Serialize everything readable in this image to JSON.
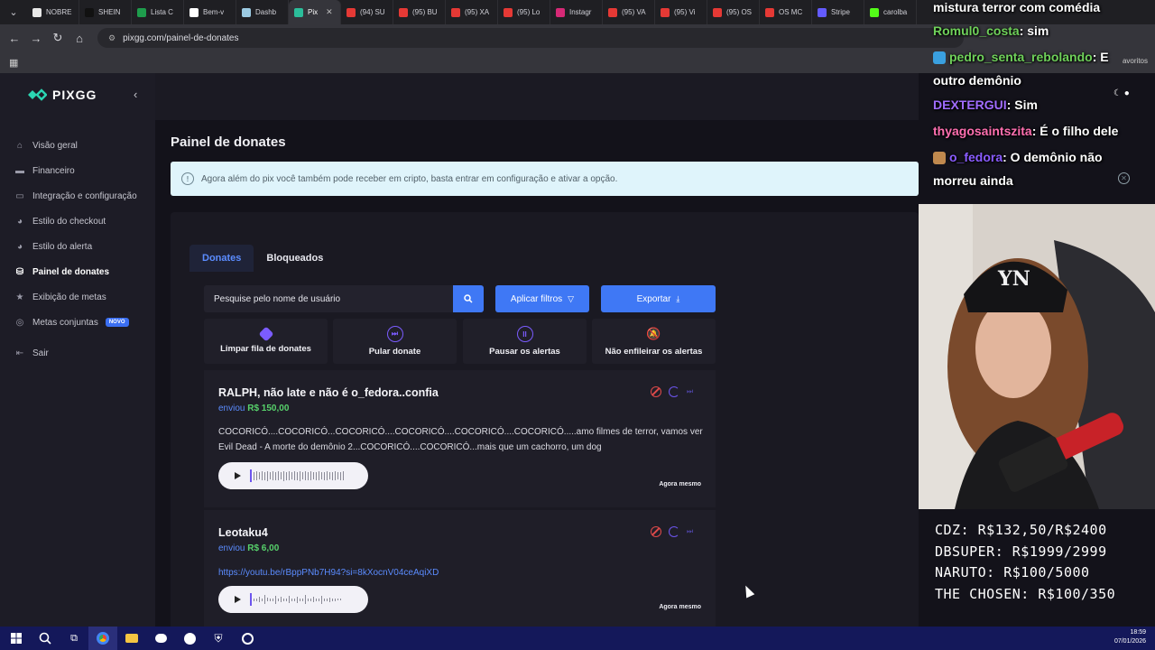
{
  "browser": {
    "tabs": [
      {
        "label": "NOBRE",
        "color": "#e8e8e8"
      },
      {
        "label": "SHEIN",
        "color": "#111111"
      },
      {
        "label": "Lista C",
        "color": "#1e9c4c"
      },
      {
        "label": "Bem-v",
        "color": "#ffffff"
      },
      {
        "label": "Dashb",
        "color": "#9ccbe3"
      },
      {
        "label": "Pix",
        "color": "#2bbd9a"
      },
      {
        "label": "(94) SU",
        "color": "#e53935"
      },
      {
        "label": "(95) BU",
        "color": "#e53935"
      },
      {
        "label": "(95) XA",
        "color": "#e53935"
      },
      {
        "label": "(95) Lo",
        "color": "#e53935"
      },
      {
        "label": "Instagr",
        "color": "#d62976"
      },
      {
        "label": "(95) VA",
        "color": "#e53935"
      },
      {
        "label": "(95) Vi",
        "color": "#e53935"
      },
      {
        "label": "(95) OS",
        "color": "#e53935"
      },
      {
        "label": "OS MC",
        "color": "#e53935"
      },
      {
        "label": "Stripe",
        "color": "#635bff"
      },
      {
        "label": "carolba",
        "color": "#53fc18"
      }
    ],
    "active_tab_index": 5,
    "url": "pixgg.com/painel-de-donates",
    "bookmarks_label": "avoritos"
  },
  "sidebar": {
    "brand": "PIXGG",
    "items": [
      {
        "label": "Visão geral",
        "icon": "home-icon"
      },
      {
        "label": "Financeiro",
        "icon": "wallet-icon"
      },
      {
        "label": "Integração e configuração",
        "icon": "plug-icon"
      },
      {
        "label": "Estilo do checkout",
        "icon": "palette-icon"
      },
      {
        "label": "Estilo do alerta",
        "icon": "palette-icon"
      },
      {
        "label": "Painel de donates",
        "icon": "donate-icon",
        "active": true
      },
      {
        "label": "Exibição de metas",
        "icon": "star-icon"
      },
      {
        "label": "Metas conjuntas",
        "icon": "target-icon",
        "badge": "NOVO"
      },
      {
        "label": "Sair",
        "icon": "logout-icon"
      }
    ]
  },
  "main": {
    "title": "Painel de donates",
    "info": "Agora além do pix você também pode receber em cripto, basta entrar em configuração e ativar a opção.",
    "tabs": [
      "Donates",
      "Bloqueados"
    ],
    "search_placeholder": "Pesquise pelo nome de usuário",
    "filter_button": "Aplicar filtros",
    "export_button": "Exportar",
    "actions": [
      {
        "label": "Limpar fila de donates",
        "icon": "eraser-icon"
      },
      {
        "label": "Pular donate",
        "icon": "skip-icon"
      },
      {
        "label": "Pausar os alertas",
        "icon": "pause-icon"
      },
      {
        "label": "Não enfileirar os alertas",
        "icon": "bell-off-icon"
      }
    ],
    "donates": [
      {
        "name": "RALPH, não late e não é o_fedora..confia",
        "sent_label": "enviou",
        "amount": "R$ 150,00",
        "message": "COCORICÓ....COCORICÓ...COCORICÓ....COCORICÓ....COCORICÓ....COCORICÓ.....amo filmes de terror, vamos ver Evil Dead - A morte do demônio 2...COCORICÓ....COCORICÓ...mais que um cachorro, um dog",
        "time": "Agora mesmo"
      },
      {
        "name": "Leotaku4",
        "sent_label": "enviou",
        "amount": "R$ 6,00",
        "link": "https://youtu.be/rBppPNb7H94?si=8kXocnV04ceAqiXD",
        "time": "Agora mesmo"
      }
    ]
  },
  "chat": [
    {
      "user": "",
      "text": "mistura terror com comédia",
      "color": "#ffffff"
    },
    {
      "user": "Romul0_costa",
      "text": ": sim",
      "color": "#6fd15a"
    },
    {
      "user": "pedro_senta_rebolando",
      "text": ": E",
      "color": "#6fd15a"
    },
    {
      "user": "",
      "text": "outro demônio",
      "color": "#ffffff"
    },
    {
      "user": "DEXTERGUI",
      "text": ": Sim",
      "color": "#a06cff"
    },
    {
      "user": "thyagosaintszita",
      "text": ": É o filho dele",
      "color": "#ff6fb0"
    },
    {
      "user": "o_fedora",
      "text": ": O demônio não",
      "color": "#8a5cff"
    },
    {
      "user": "",
      "text": "morreu ainda",
      "color": "#ffffff"
    }
  ],
  "goals": [
    "CDZ: R$132,50/R$2400",
    "DBSUPER: R$1999/2999",
    "NARUTO: R$100/5000",
    "THE CHOSEN: R$100/350"
  ],
  "taskbar": {
    "time": "18:59",
    "date": "07/01/2026"
  }
}
